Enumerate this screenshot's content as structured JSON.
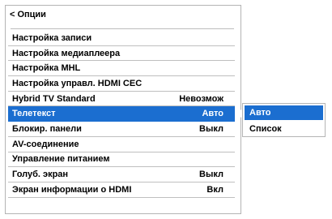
{
  "header": {
    "back_label": "<",
    "title": "Опции"
  },
  "menu": [
    {
      "label": "Настройка записи",
      "value": ""
    },
    {
      "label": "Настройка медиаплеера",
      "value": ""
    },
    {
      "label": "Настройка MHL",
      "value": ""
    },
    {
      "label": "Настройка управл. HDMI CEC",
      "value": ""
    },
    {
      "label": "Hybrid TV Standard",
      "value": "Невозмож"
    },
    {
      "label": "Телетекст",
      "value": "Авто"
    },
    {
      "label": "Блокир. панели",
      "value": "Выкл"
    },
    {
      "label": "AV-соединение",
      "value": ""
    },
    {
      "label": "Управление питанием",
      "value": ""
    },
    {
      "label": "Голуб. экран",
      "value": "Выкл"
    },
    {
      "label": "Экран информации о HDMI",
      "value": "Вкл"
    }
  ],
  "selected_index": 5,
  "submenu": {
    "options": [
      "Авто",
      "Список"
    ],
    "selected_index": 0
  },
  "colors": {
    "highlight": "#1b6ed0"
  }
}
